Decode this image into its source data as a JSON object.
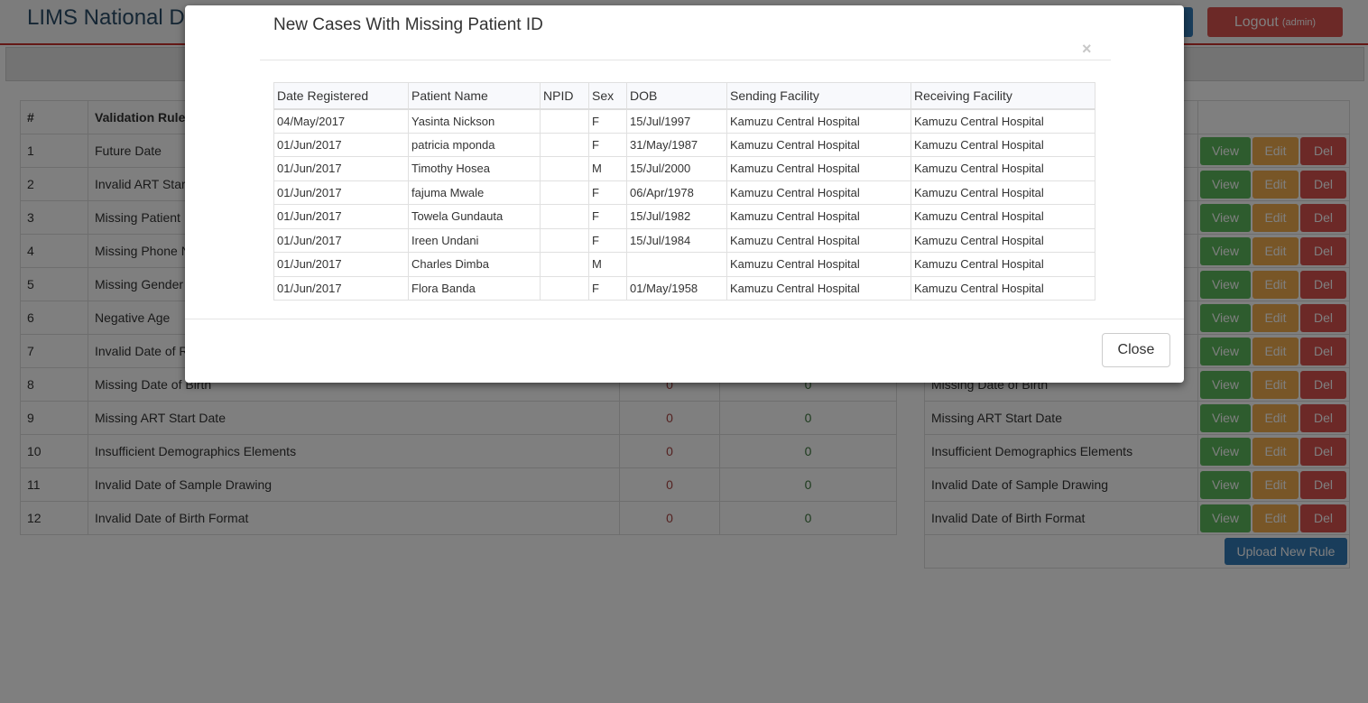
{
  "app": {
    "title": "LIMS National Data Quality Dashboard",
    "logout_label": "Logout",
    "logout_user": "(admin)"
  },
  "left_table": {
    "headers": [
      "#",
      "Validation Rule",
      "",
      ""
    ],
    "rows": [
      {
        "num": "1",
        "name": "Future Date",
        "a": "",
        "b": ""
      },
      {
        "num": "2",
        "name": "Invalid ART Start Date",
        "a": "",
        "b": ""
      },
      {
        "num": "3",
        "name": "Missing Patient ID",
        "a": "",
        "b": ""
      },
      {
        "num": "4",
        "name": "Missing Phone Number",
        "a": "",
        "b": ""
      },
      {
        "num": "5",
        "name": "Missing Gender",
        "a": "",
        "b": ""
      },
      {
        "num": "6",
        "name": "Negative Age",
        "a": "",
        "b": ""
      },
      {
        "num": "7",
        "name": "Invalid Date of Receipt",
        "a": "",
        "b": ""
      },
      {
        "num": "8",
        "name": "Missing Date of Birth",
        "a": "0",
        "b": "0"
      },
      {
        "num": "9",
        "name": "Missing ART Start Date",
        "a": "0",
        "b": "0"
      },
      {
        "num": "10",
        "name": "Insufficient Demographics Elements",
        "a": "0",
        "b": "0"
      },
      {
        "num": "11",
        "name": "Invalid Date of Sample Drawing",
        "a": "0",
        "b": "0"
      },
      {
        "num": "12",
        "name": "Invalid Date of Birth Format",
        "a": "0",
        "b": "0"
      }
    ]
  },
  "right_table": {
    "rows": [
      {
        "name": ""
      },
      {
        "name": ""
      },
      {
        "name": ""
      },
      {
        "name": ""
      },
      {
        "name": ""
      },
      {
        "name": ""
      },
      {
        "name": ""
      },
      {
        "name": "Missing Date of Birth"
      },
      {
        "name": "Missing ART Start Date"
      },
      {
        "name": "Insufficient Demographics Elements"
      },
      {
        "name": "Invalid Date of Sample Drawing"
      },
      {
        "name": "Invalid Date of Birth Format"
      }
    ],
    "view_label": "View",
    "edit_label": "Edit",
    "del_label": "Del",
    "upload_label": "Upload New Rule"
  },
  "modal": {
    "title": "New Cases With Missing Patient ID",
    "close_x": "×",
    "close_label": "Close",
    "columns": [
      "Date Registered",
      "Patient Name",
      "NPID",
      "Sex",
      "DOB",
      "Sending Facility",
      "Receiving Facility"
    ],
    "rows": [
      [
        "04/May/2017",
        "Yasinta Nickson",
        "",
        "F",
        "15/Jul/1997",
        "Kamuzu Central Hospital",
        "Kamuzu Central Hospital"
      ],
      [
        "01/Jun/2017",
        "patricia mponda",
        "",
        "F",
        "31/May/1987",
        "Kamuzu Central Hospital",
        "Kamuzu Central Hospital"
      ],
      [
        "01/Jun/2017",
        "Timothy Hosea",
        "",
        "M",
        "15/Jul/2000",
        "Kamuzu Central Hospital",
        "Kamuzu Central Hospital"
      ],
      [
        "01/Jun/2017",
        "fajuma Mwale",
        "",
        "F",
        "06/Apr/1978",
        "Kamuzu Central Hospital",
        "Kamuzu Central Hospital"
      ],
      [
        "01/Jun/2017",
        "Towela Gundauta",
        "",
        "F",
        "15/Jul/1982",
        "Kamuzu Central Hospital",
        "Kamuzu Central Hospital"
      ],
      [
        "01/Jun/2017",
        "Ireen Undani",
        "",
        "F",
        "15/Jul/1984",
        "Kamuzu Central Hospital",
        "Kamuzu Central Hospital"
      ],
      [
        "01/Jun/2017",
        "Charles Dimba",
        "",
        "M",
        "",
        "Kamuzu Central Hospital",
        "Kamuzu Central Hospital"
      ],
      [
        "01/Jun/2017",
        "Flora Banda",
        "",
        "F",
        "01/May/1958",
        "Kamuzu Central Hospital",
        "Kamuzu Central Hospital"
      ]
    ]
  }
}
